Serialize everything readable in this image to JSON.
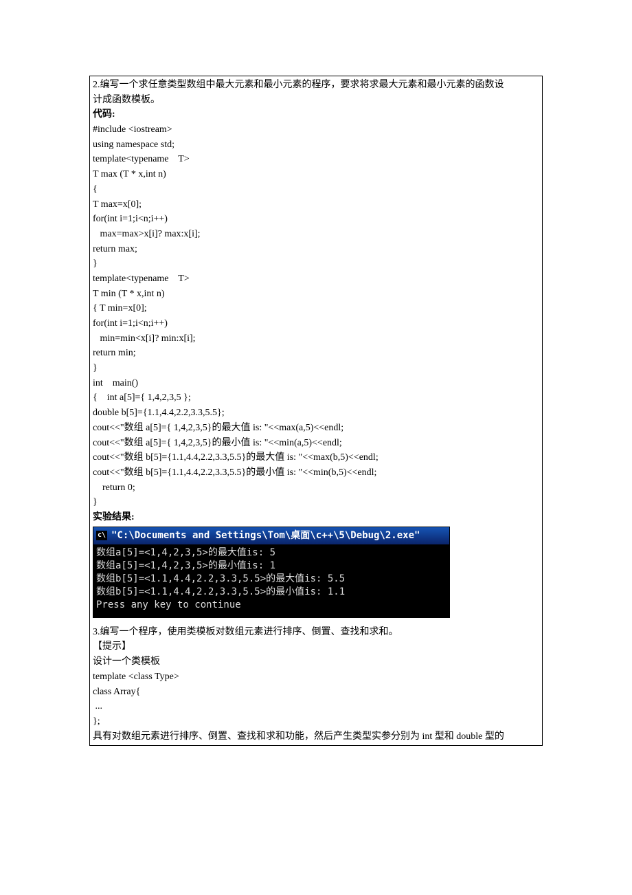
{
  "problem2": {
    "desc_l1": "2.编写一个求任意类型数组中最大元素和最小元素的程序，要求将求最大元素和最小元素的函数设",
    "desc_l2": "计成函数模板。",
    "code_label": "代码:",
    "code": [
      "#include <iostream>",
      "using namespace std;",
      "template<typename    T>",
      "T max (T * x,int n)",
      "{",
      "T max=x[0];",
      "for(int i=1;i<n;i++)",
      "   max=max>x[i]? max:x[i];",
      "return max;",
      "}",
      "template<typename    T>",
      "T min (T * x,int n)",
      "{ T min=x[0];",
      "for(int i=1;i<n;i++)",
      "   min=min<x[i]? min:x[i];",
      "return min;",
      "}",
      "int    main()",
      "{    int a[5]={ 1,4,2,3,5 };",
      "double b[5]={1.1,4.4,2.2,3.3,5.5};",
      "cout<<\"数组 a[5]={ 1,4,2,3,5}的最大值 is: \"<<max(a,5)<<endl;",
      "cout<<\"数组 a[5]={ 1,4,2,3,5}的最小值 is: \"<<min(a,5)<<endl;",
      "cout<<\"数组 b[5]={1.1,4.4,2.2,3.3,5.5}的最大值 is: \"<<max(b,5)<<endl;",
      "cout<<\"数组 b[5]={1.1,4.4,2.2,3.3,5.5}的最小值 is: \"<<min(b,5)<<endl;",
      "    return 0;",
      "}"
    ],
    "result_label": "实验结果:"
  },
  "terminal": {
    "title": "\"C:\\Documents and Settings\\Tom\\桌面\\c++\\5\\Debug\\2.exe\"",
    "lines": [
      "数组a[5]=<1,4,2,3,5>的最大值is: 5",
      "数组a[5]=<1,4,2,3,5>的最小值is: 1",
      "数组b[5]=<1.1,4.4,2.2,3.3,5.5>的最大值is: 5.5",
      "数组b[5]=<1.1,4.4,2.2,3.3,5.5>的最小值is: 1.1",
      "Press any key to continue"
    ]
  },
  "problem3": {
    "lines": [
      "3.编写一个程序，使用类模板对数组元素进行排序、倒置、查找和求和。",
      "【提示】",
      "设计一个类模板",
      "template <class Type>",
      "class Array{",
      " ...",
      "};",
      "具有对数组元素进行排序、倒置、查找和求和功能，然后产生类型实参分别为 int 型和 double 型的"
    ]
  }
}
